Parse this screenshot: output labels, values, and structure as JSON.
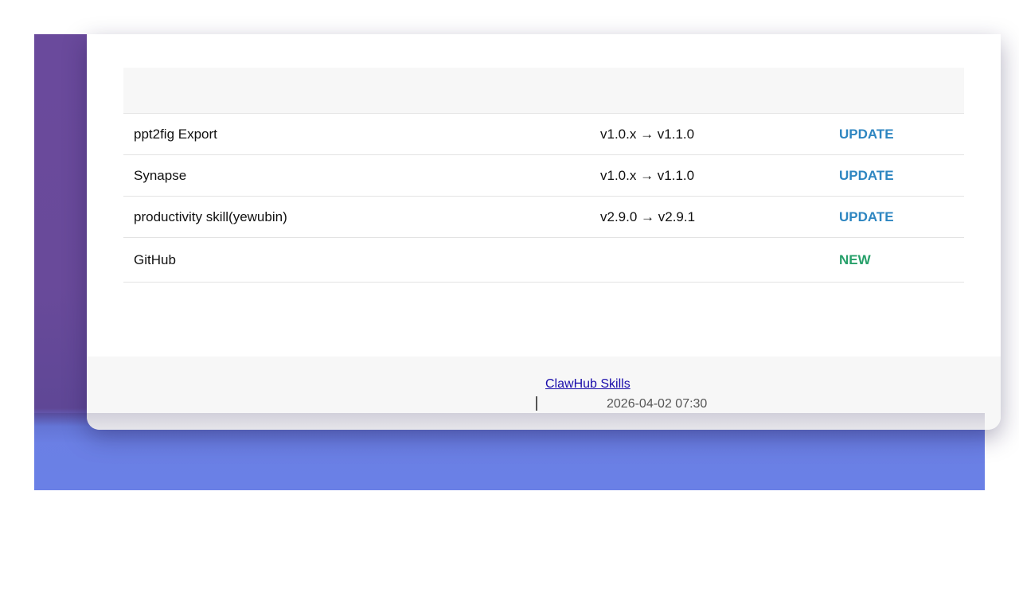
{
  "rows": [
    {
      "name": "ppt2fig Export",
      "version": "v1.0.x → v1.1.0",
      "status": "UPDATE"
    },
    {
      "name": "Synapse",
      "version": "v1.0.x → v1.1.0",
      "status": "UPDATE"
    },
    {
      "name": "productivity skill(yewubin)",
      "version": "v2.9.0 → v2.9.1",
      "status": "UPDATE"
    },
    {
      "name": "GitHub",
      "version": "",
      "status": "NEW"
    }
  ],
  "footer": {
    "link_label": "ClawHub Skills",
    "timestamp": "2026-04-02 07:30"
  },
  "colors": {
    "update": "#2e86c1",
    "new": "#27a06a",
    "background_top": "#6a4a9c",
    "background_bottom": "#6a80e6"
  }
}
